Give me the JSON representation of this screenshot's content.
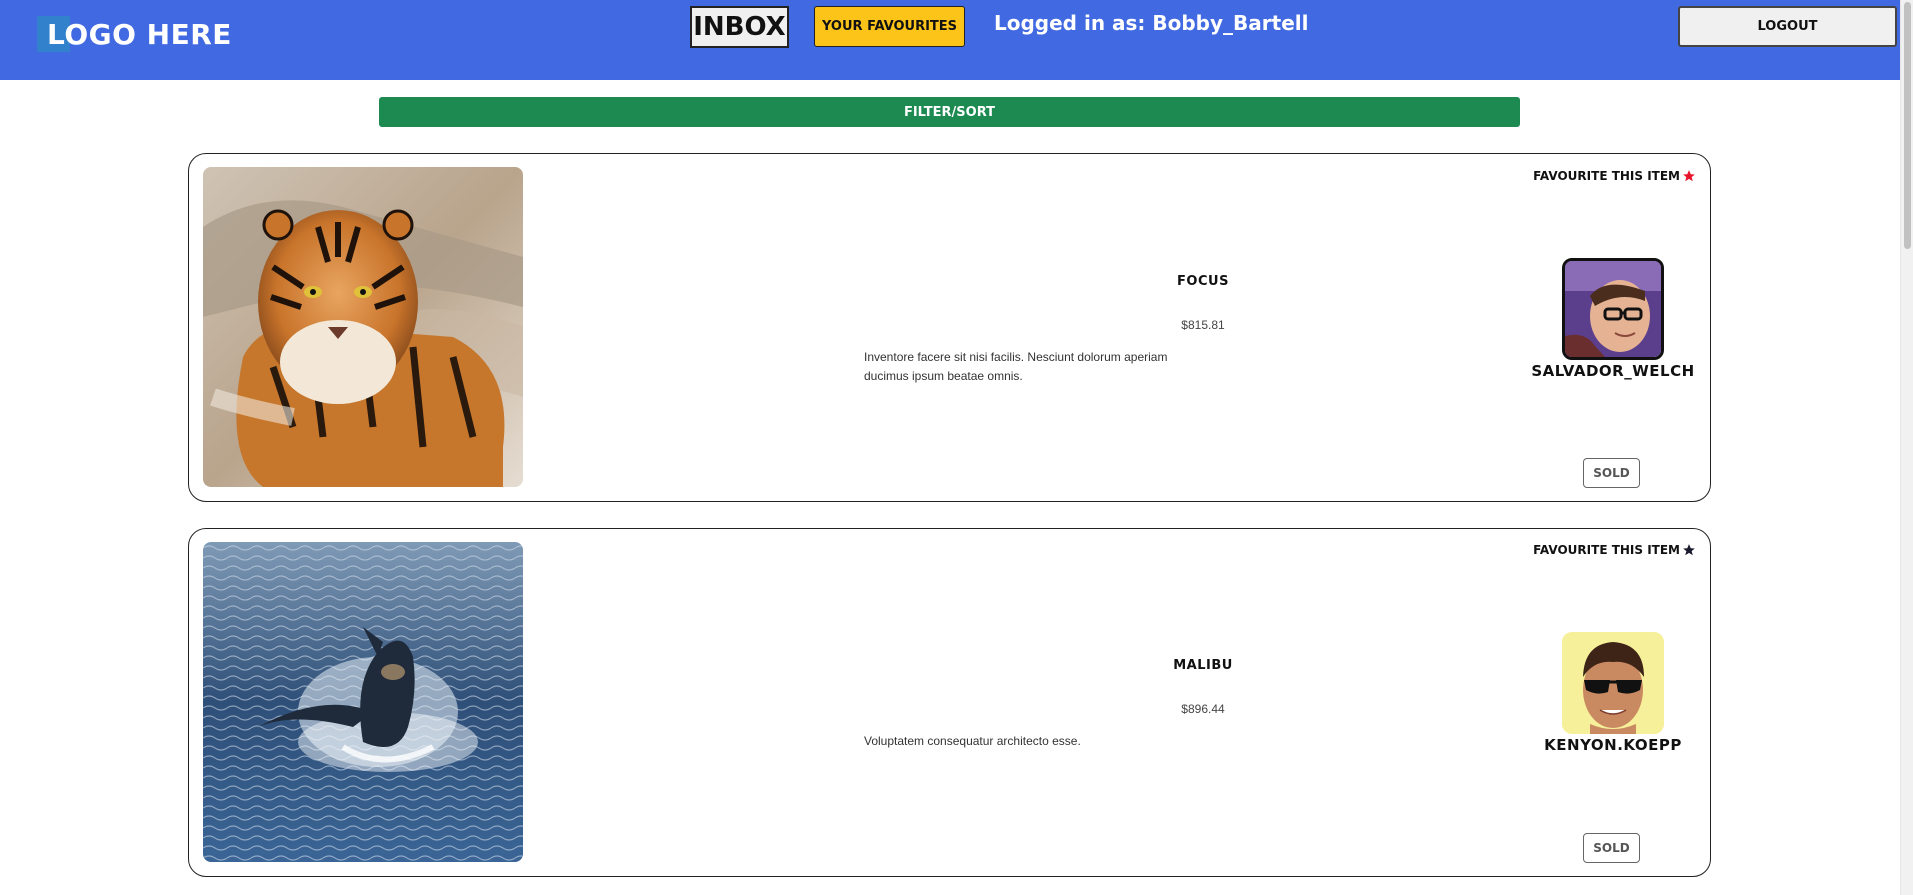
{
  "header": {
    "logo_text": "LOGO HERE",
    "inbox_label": "INBOX",
    "favourites_label": "YOUR FAVOURITES",
    "logged_in_text": "Logged in as: Bobby_Bartell",
    "logout_label": "LOGOUT"
  },
  "filter_label": "FILTER/SORT",
  "colors": {
    "header_bg": "#4169e1",
    "filter_bg": "#1d8a52",
    "favourites_bg": "#fcc419",
    "star_active": "#e8122b",
    "star_inactive": "#1a1a2e"
  },
  "items": [
    {
      "title": "FOCUS",
      "price": "$815.81",
      "description": "Inventore facere sit nisi facilis. Nesciunt dolorum aperiam ducimus ipsum beatae omnis.",
      "favourite_label": "FAVOURITE THIS ITEM",
      "favourited": true,
      "seller": "SALVADOR_WELCH",
      "status_label": "SOLD",
      "image_icon": "tiger-photo",
      "avatar_icon": "man-with-glasses-avatar"
    },
    {
      "title": "MALIBU",
      "price": "$896.44",
      "description": "Voluptatem consequatur architecto esse.",
      "favourite_label": "FAVOURITE THIS ITEM",
      "favourited": false,
      "seller": "KENYON.KOEPP",
      "status_label": "SOLD",
      "image_icon": "whale-photo",
      "avatar_icon": "cartoon-man-sunglasses-avatar"
    }
  ]
}
